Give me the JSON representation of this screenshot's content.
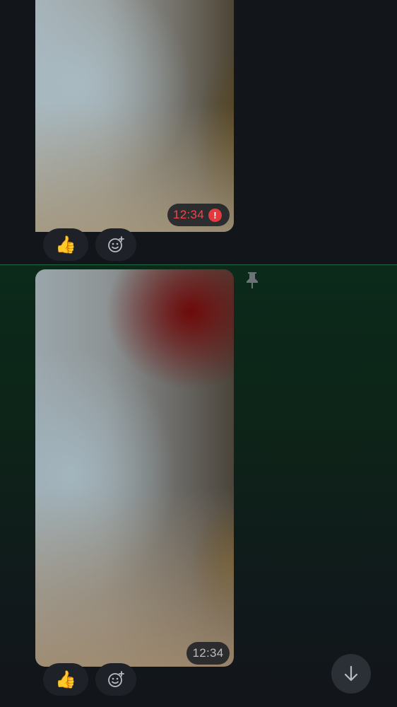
{
  "messages": [
    {
      "id": "msg-1",
      "timestamp": "12:34",
      "status": "error",
      "error_icon_text": "!",
      "reactions": {
        "like_emoji": "👍",
        "add_icon": "add-reaction-icon"
      }
    },
    {
      "id": "msg-2",
      "timestamp": "12:34",
      "pinned": true,
      "pin_icon": "pin-icon",
      "reactions": {
        "like_emoji": "👍",
        "add_icon": "add-reaction-icon"
      }
    }
  ],
  "scroll_button": {
    "icon": "arrow-down-icon"
  },
  "colors": {
    "background": "#12151a",
    "selected_background": "#0b2a1a",
    "error": "#f0454a",
    "chip": "#1e2228"
  }
}
